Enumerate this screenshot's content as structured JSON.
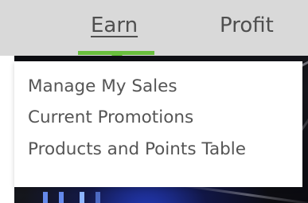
{
  "nav": {
    "items": [
      {
        "label": "Earn",
        "active": true
      },
      {
        "label": "Profit",
        "active": false
      }
    ],
    "active_color": "#69bf3d"
  },
  "dropdown": {
    "items": [
      {
        "label": "Manage My Sales"
      },
      {
        "label": "Current Promotions"
      },
      {
        "label": "Products and Points Table"
      }
    ]
  }
}
